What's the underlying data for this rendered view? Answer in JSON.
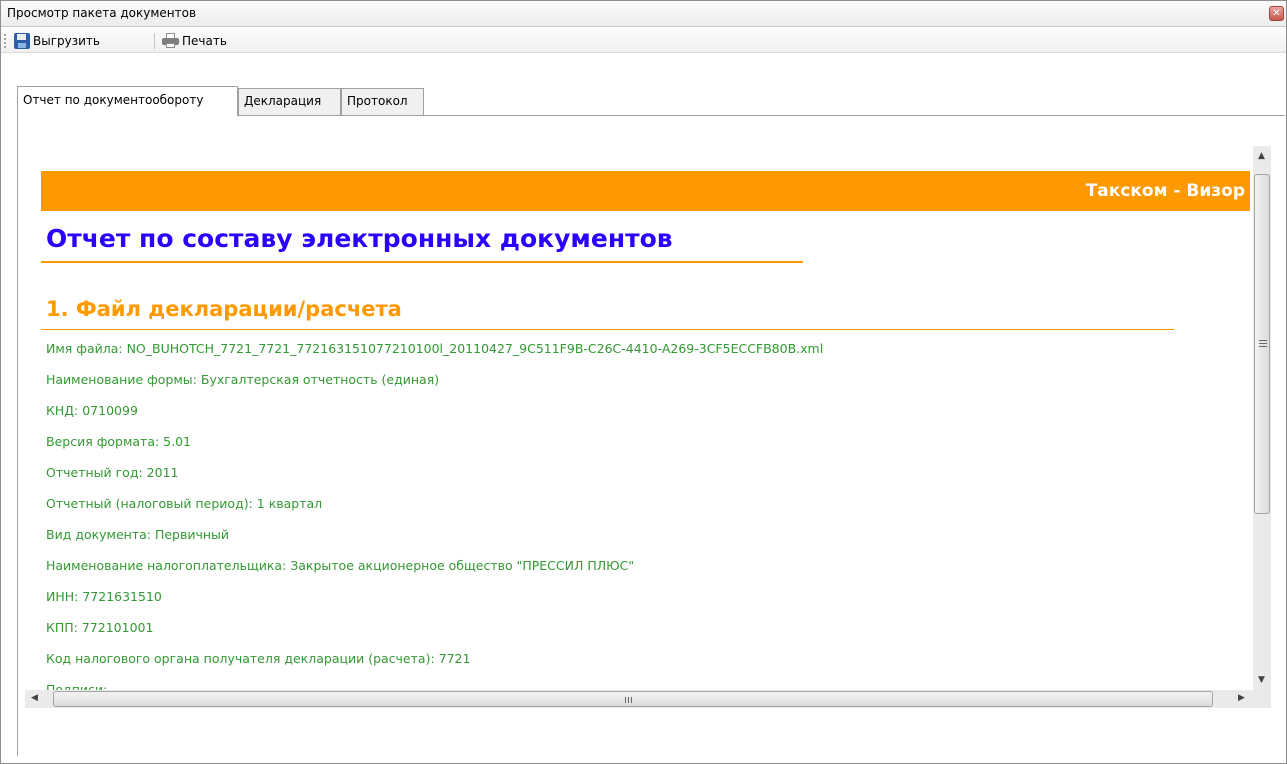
{
  "window": {
    "title": "Просмотр пакета документов"
  },
  "toolbar": {
    "export_label": "Выгрузить",
    "print_label": "Печать"
  },
  "tabs": [
    {
      "label": "Отчет по документообороту",
      "active": true
    },
    {
      "label": "Декларация",
      "active": false
    },
    {
      "label": "Протокол",
      "active": false
    }
  ],
  "report": {
    "banner": "Такском - Визор",
    "title": "Отчет по составу электронных документов",
    "section_title": "1. Файл декларации/расчета",
    "fields": [
      "Имя файла: NO_BUHOTCH_7721_7721_772163151077210100l_20110427_9C511F9B-C26C-4410-A269-3CF5ECCFB80B.xml",
      "Наименование формы: Бухгалтерская отчетность (единая)",
      "КНД: 0710099",
      "Версия формата: 5.01",
      "Отчетный год: 2011",
      "Отчетный (налоговый период): 1 квартал",
      "Вид документа: Первичный",
      "Наименование налогоплательщика: Закрытое акционерное общество \"ПРЕССИЛ ПЛЮС\"",
      "ИНН: 7721631510",
      "КПП: 772101001",
      "Код налогового органа получателя декларации (расчета): 7721",
      "Подписи:"
    ]
  },
  "colors": {
    "banner": "#ff9900",
    "title": "#2b00ff",
    "section": "#ff9900",
    "field_text": "#339933"
  },
  "icons": {
    "export": "floppy-disk-icon",
    "print": "printer-icon",
    "close": "close-icon"
  }
}
